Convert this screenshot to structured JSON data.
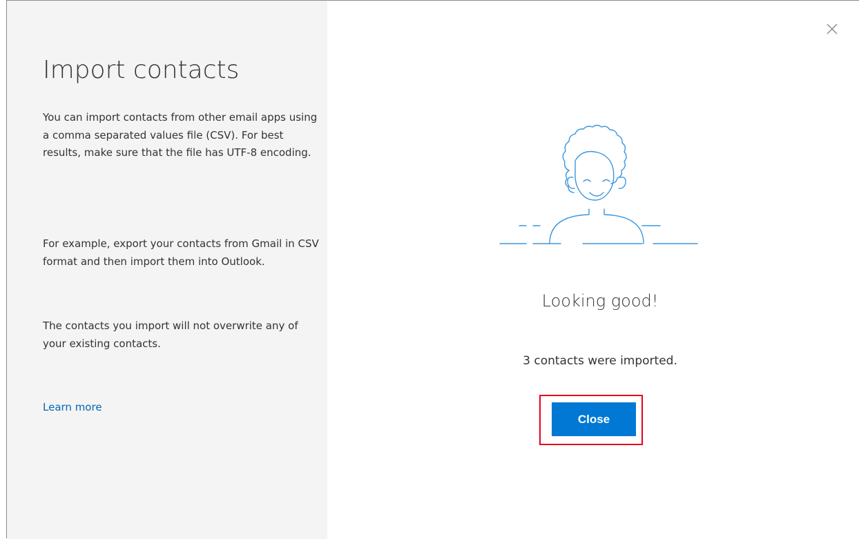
{
  "dialog": {
    "title": "Import contacts",
    "description": [
      "You can import contacts from other email apps using a comma separated values file (CSV). For best results, make sure that the file has UTF-8 encoding.",
      "For example, export your contacts from Gmail in CSV format and then import them into Outlook.",
      "The contacts you import will not overwrite any of your existing contacts."
    ],
    "learn_more_label": "Learn more",
    "close_icon": "close-icon"
  },
  "result": {
    "illustration_icon": "smiling-person-illustration",
    "title": "Looking good!",
    "message": "3 contacts were imported.",
    "close_button_label": "Close"
  },
  "colors": {
    "accent": "#0078d4",
    "link": "#0067b8",
    "highlight_border": "#e3001b",
    "left_panel_bg": "#f4f4f4",
    "illustration": "#3a96dd"
  }
}
